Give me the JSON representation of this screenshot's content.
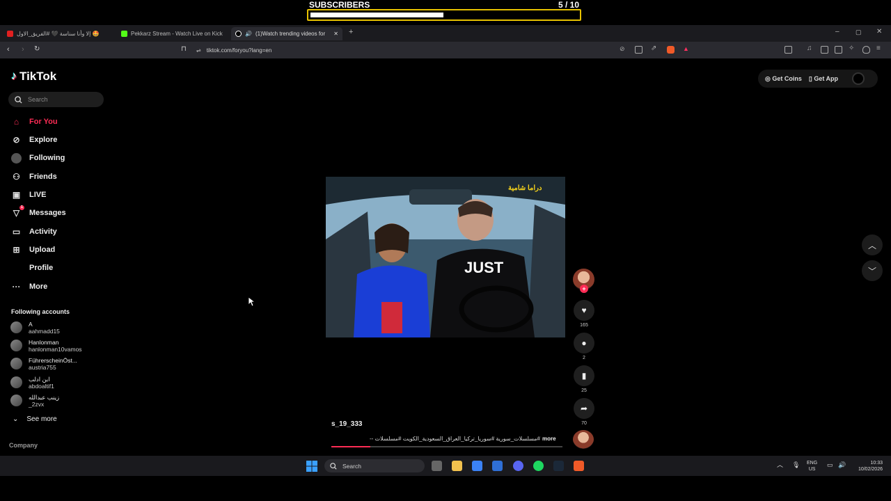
{
  "overlay": {
    "label": "SUBSCRIBERS",
    "count": "5  / 10",
    "progress": 0.5
  },
  "browser": {
    "tabs": [
      {
        "label": "إلا وأنا سناسة 🖤 #الفريق_الاول 🤩",
        "icon_color": "#e02020"
      },
      {
        "label": "Pekkarz Stream - Watch Live on Kick",
        "icon_color": "#53fc18"
      },
      {
        "label": "(1)Watch trending videos for",
        "icon_color": "#ffffff"
      }
    ],
    "new_tab": "+",
    "url": "tiktok.com/foryou?lang=en",
    "window_controls": [
      "–",
      "▢",
      "✕"
    ]
  },
  "tiktok": {
    "logo": "TikTok",
    "search_placeholder": "Search",
    "nav": [
      {
        "label": "For You",
        "icon": "home-icon"
      },
      {
        "label": "Explore",
        "icon": "compass-icon"
      },
      {
        "label": "Following",
        "icon": "following-icon"
      },
      {
        "label": "Friends",
        "icon": "friends-icon"
      },
      {
        "label": "LIVE",
        "icon": "live-icon"
      },
      {
        "label": "Messages",
        "icon": "messages-icon"
      },
      {
        "label": "Activity",
        "icon": "activity-icon"
      },
      {
        "label": "Upload",
        "icon": "upload-icon"
      },
      {
        "label": "Profile",
        "icon": "profile-icon"
      },
      {
        "label": "More",
        "icon": "more-icon"
      }
    ],
    "messages_badge": "1",
    "following_heading": "Following accounts",
    "accounts": [
      {
        "name": "A",
        "handle": "aahmadd15"
      },
      {
        "name": "Hanlonman",
        "handle": "hanlonman10vamos"
      },
      {
        "name": "FührerscheinÖst...",
        "handle": "austria755"
      },
      {
        "name": "ابن ادلب",
        "handle": "abdoaltif1"
      },
      {
        "name": "زينب عبدالله",
        "handle": "_2zvx"
      }
    ],
    "see_more": "See more",
    "company": "Company",
    "get_coins": "Get Coins",
    "get_app": "Get App",
    "video": {
      "watermark": "دراما شامية",
      "shirt_text": "JUST",
      "author": "s_19_333",
      "description": "#مسلسلات_سورية #سوريا_تركيا_العراق_السعودية_الكويت #مسلسلات --",
      "more": "more",
      "progress": 0.17,
      "likes": "165",
      "comments": "2",
      "saves": "25",
      "shares": "70"
    }
  },
  "taskbar": {
    "search": "Search",
    "lang": "ENG",
    "region": "US",
    "time": "10:33",
    "date": "10/02/2026"
  }
}
